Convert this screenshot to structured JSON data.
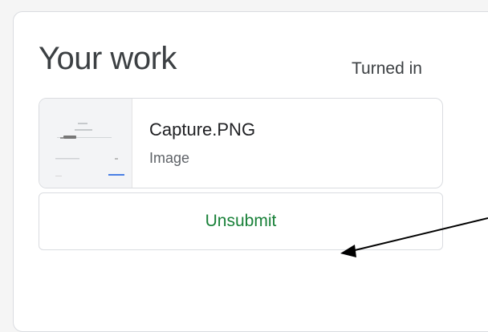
{
  "section": {
    "title": "Your work",
    "status": "Turned in"
  },
  "attachment": {
    "name": "Capture.PNG",
    "type": "Image",
    "thumbnail_icon": "image-thumbnail"
  },
  "actions": {
    "unsubmit_label": "Unsubmit"
  },
  "annotation": {
    "arrow_icon": "pointer-arrow-icon"
  },
  "colors": {
    "accent": "#188038",
    "border": "#dadce0",
    "text": "#3c4043"
  }
}
